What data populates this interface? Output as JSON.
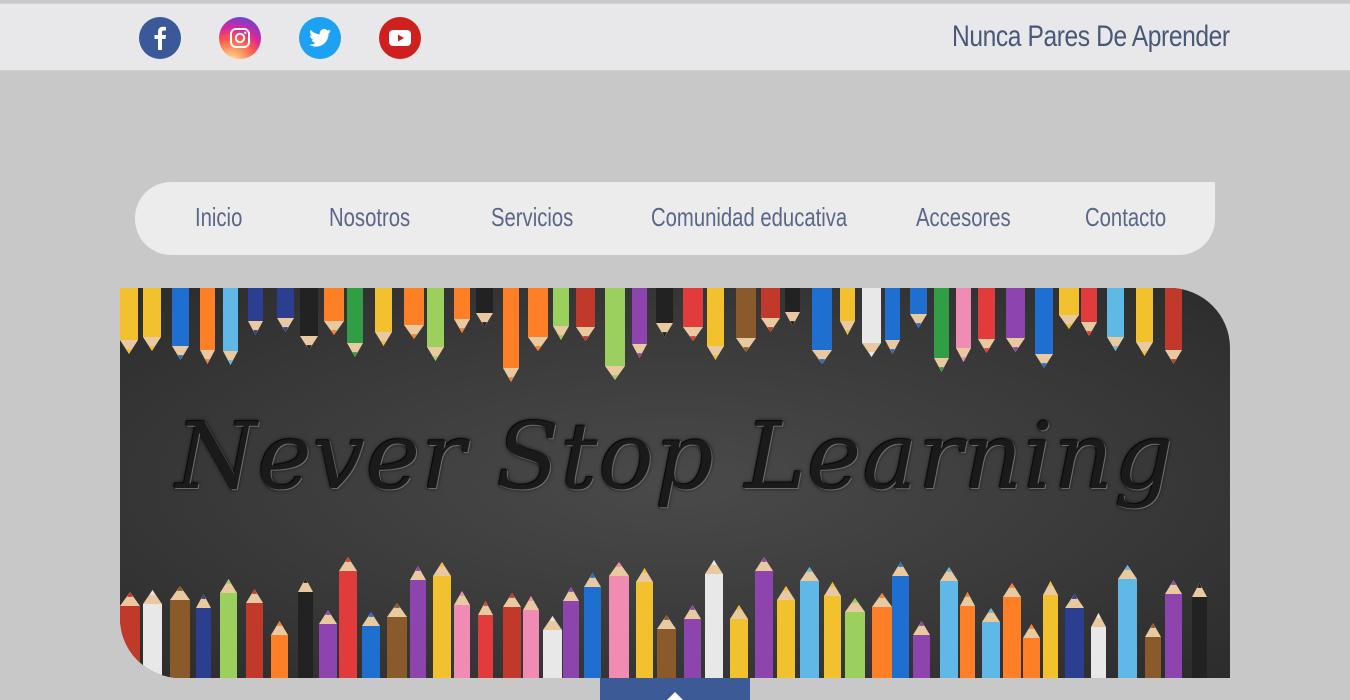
{
  "header": {
    "site_title": "Nunca Pares De Aprender",
    "social": [
      {
        "name": "facebook",
        "icon": "facebook-icon",
        "color": "#3b5998"
      },
      {
        "name": "instagram",
        "icon": "instagram-icon",
        "color": "#d6249f"
      },
      {
        "name": "twitter",
        "icon": "twitter-icon",
        "color": "#1da1f2"
      },
      {
        "name": "youtube",
        "icon": "youtube-icon",
        "color": "#cd201f"
      }
    ]
  },
  "nav": {
    "items": [
      {
        "label": "Inicio"
      },
      {
        "label": "Nosotros"
      },
      {
        "label": "Servicios"
      },
      {
        "label": "Comunidad educativa"
      },
      {
        "label": "Accesores"
      },
      {
        "label": "Contacto"
      }
    ]
  },
  "hero": {
    "title": "Never Stop Learning"
  },
  "colors": {
    "page_bg": "#c8c8c8",
    "topbar_bg": "#e8e8ea",
    "nav_text": "#5a6788",
    "scroll_top_bg": "#3c5a96"
  }
}
